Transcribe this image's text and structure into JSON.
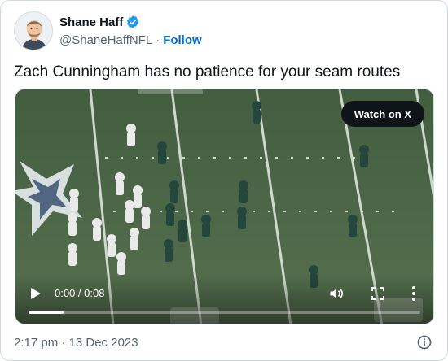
{
  "author": {
    "display_name": "Shane Haff",
    "handle": "@ShaneHaffNFL",
    "separator": "·",
    "follow_label": "Follow",
    "verified": true,
    "verified_color": "#1d9bf0"
  },
  "tweet": {
    "text": "Zach Cunningham has no patience for your seam routes"
  },
  "media": {
    "watch_label": "Watch on X",
    "time_display": "0:00 / 0:08",
    "progress": 0.09,
    "icons": [
      "play-icon",
      "volume-icon",
      "fullscreen-icon",
      "more-vertical-icon"
    ]
  },
  "footer": {
    "timestamp": "2:17 pm · 13 Dec 2023",
    "info_icon": "info-icon"
  },
  "colors": {
    "link": "#006fd6",
    "text": "#0f1419",
    "secondary": "#536471",
    "border": "#cfd9de"
  }
}
